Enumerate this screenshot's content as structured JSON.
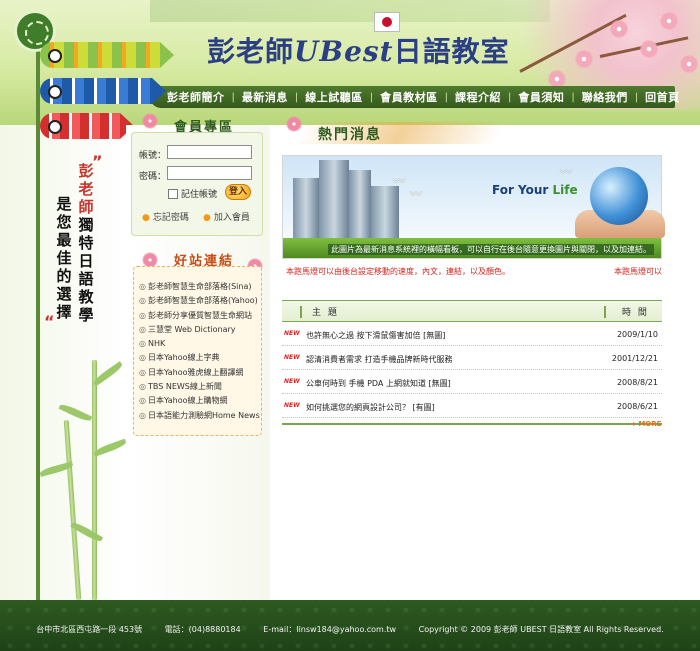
{
  "header": {
    "title_prefix": "彭老師",
    "title_brand": "UBest",
    "title_suffix": "日語教室"
  },
  "nav": {
    "items": [
      "彭老師簡介",
      "最新消息",
      "線上試聽區",
      "會員教材區",
      "課程介紹",
      "會員須知",
      "聯絡我們",
      "回首頁"
    ]
  },
  "slogan": {
    "name": "彭老師",
    "line1": "獨特日語教學",
    "line2": "是您最佳的選擇"
  },
  "member": {
    "title": "會員專區",
    "account_label": "帳號：",
    "password_label": "密碼：",
    "remember_label": "記住帳號",
    "login_button": "登入",
    "forgot_link": "忘記密碼",
    "join_link": "加入會員"
  },
  "links": {
    "title": "好站連結",
    "items": [
      "彭老師智慧生命部落格(Sina)",
      "彭老師智慧生命部落格(Yahoo)",
      "彭老師分享優質智慧生命網站",
      "三慧堂 Web Dictionary",
      "NHK",
      "日本Yahoo線上字典",
      "日本Yahoo雅虎線上翻譯網",
      "TBS NEWS線上新聞",
      "日本Yahoo線上購物網",
      "日本語能力測驗網Home News"
    ]
  },
  "hot_news": {
    "title": "熱門消息",
    "banner_slogan_a": "For Your ",
    "banner_slogan_b": "Life",
    "banner_caption": "此圖片為最新消息系統裡的橫幅看板，可以自行在後台隨意更換圖片與關閉，以及加連結。",
    "marquee_left": "本跑馬燈可以由後台設定移動的速度，內文，連結，以及顏色。",
    "marquee_right": "本跑馬燈可以",
    "col_subject": "主 題",
    "col_time": "時 間",
    "new_tag": "NEW",
    "rows": [
      {
        "title": "也許無心之過 按下滑鼠傷害加倍 [無圖]",
        "date": "2009/1/10"
      },
      {
        "title": "認清消費者需求 打造手機品牌新時代服務",
        "date": "2001/12/21"
      },
      {
        "title": "公車何時到 手機 PDA 上網就知道 [無圖]",
        "date": "2008/8/21"
      },
      {
        "title": "如何挑選您的網頁設計公司？ [有圖]",
        "date": "2008/6/21"
      }
    ],
    "more_label": "MORE"
  },
  "footer": {
    "address": "台中市北區西屯路一段 453號",
    "phone": "電話：(04)8880184",
    "email": "E-mail：linsw184@yahoo.com.tw",
    "copyright": "Copyright © 2009 彭老師 UBEST 日語教室 All Rights Reserved."
  },
  "colors": {
    "nav_bg": "#35591c",
    "accent_green": "#2f5b1e",
    "accent_red": "#d2231e",
    "footer_bg": "#1e4216",
    "title_blue": "#2b3f84"
  }
}
